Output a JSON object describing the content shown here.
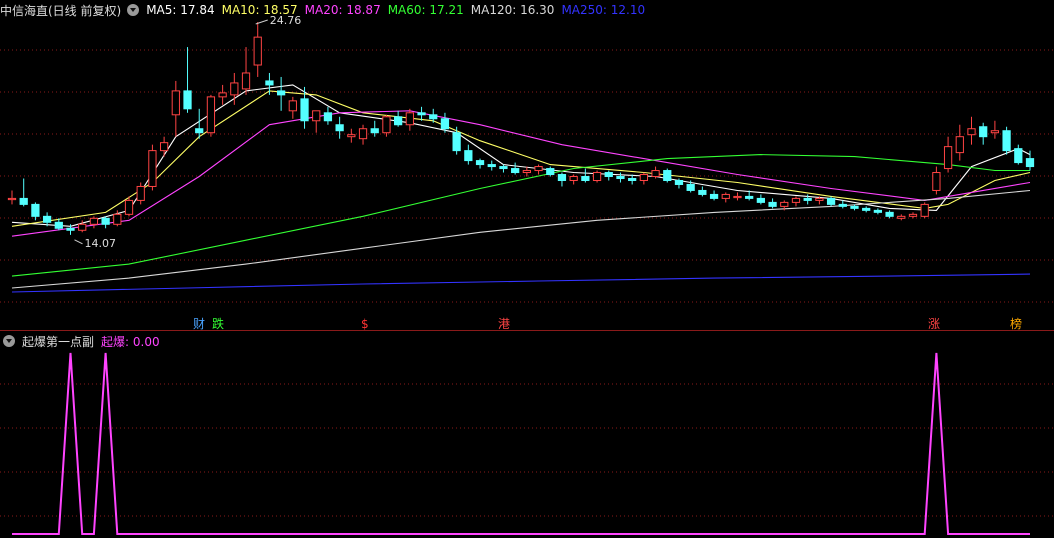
{
  "header": {
    "title": "中信海直(日线 前复权)",
    "ma5": {
      "label": "MA5: 17.84",
      "color": "#ffffff"
    },
    "ma10": {
      "label": "MA10: 18.57",
      "color": "#ffff66"
    },
    "ma20": {
      "label": "MA20: 18.87",
      "color": "#ff44ff"
    },
    "ma60": {
      "label": "MA60: 17.21",
      "color": "#33ff33"
    },
    "ma120": {
      "label": "MA120: 16.30",
      "color": "#d8d8d8"
    },
    "ma250": {
      "label": "MA250: 12.10",
      "color": "#3333ff"
    }
  },
  "annotations": {
    "high_label": "24.76",
    "low_label": "14.07"
  },
  "event_markers": [
    {
      "text": "财",
      "color": "#4aa3ff"
    },
    {
      "text": "跌",
      "color": "#33ff33"
    },
    {
      "text": "$",
      "color": "#ff3333"
    },
    {
      "text": "港",
      "color": "#ff4444"
    },
    {
      "text": "涨",
      "color": "#ff4444"
    },
    {
      "text": "榜",
      "color": "#ffaa00"
    }
  ],
  "sub_header": {
    "title": "起爆第一点副",
    "value_label": "起爆: 0.00",
    "color": "#ff44ff"
  },
  "colors": {
    "up": "#ff4444",
    "down": "#54ffff",
    "grid": "#8a1a1a",
    "signal": "#ff44ff"
  },
  "chart_data": {
    "type": "candlestick",
    "ohlc": [
      [
        15.9,
        16.3,
        15.6,
        15.9
      ],
      [
        15.9,
        16.9,
        15.5,
        15.6
      ],
      [
        15.6,
        15.7,
        14.8,
        15.0
      ],
      [
        15.0,
        15.2,
        14.5,
        14.7
      ],
      [
        14.7,
        14.9,
        14.3,
        14.4
      ],
      [
        14.4,
        14.6,
        14.07,
        14.3
      ],
      [
        14.3,
        14.8,
        14.2,
        14.6
      ],
      [
        14.6,
        15.0,
        14.4,
        14.9
      ],
      [
        14.9,
        15.0,
        14.4,
        14.6
      ],
      [
        14.6,
        15.3,
        14.5,
        15.1
      ],
      [
        15.1,
        16.0,
        15.0,
        15.8
      ],
      [
        15.8,
        16.7,
        15.6,
        16.5
      ],
      [
        16.5,
        18.6,
        16.3,
        18.3
      ],
      [
        18.3,
        19.0,
        18.0,
        18.7
      ],
      [
        20.1,
        21.8,
        19.0,
        21.3
      ],
      [
        21.3,
        23.5,
        20.2,
        20.4
      ],
      [
        19.4,
        20.4,
        18.9,
        19.2
      ],
      [
        19.2,
        21.1,
        19.0,
        21.0
      ],
      [
        21.0,
        21.6,
        20.6,
        21.2
      ],
      [
        21.1,
        22.2,
        20.6,
        21.7
      ],
      [
        21.4,
        23.5,
        21.1,
        22.2
      ],
      [
        22.6,
        24.76,
        22.0,
        24.0
      ],
      [
        21.8,
        22.2,
        21.1,
        21.6
      ],
      [
        21.3,
        22.0,
        20.3,
        21.1
      ],
      [
        20.3,
        21.0,
        19.9,
        20.8
      ],
      [
        20.9,
        21.5,
        19.4,
        19.8
      ],
      [
        19.8,
        20.3,
        19.2,
        20.3
      ],
      [
        20.2,
        20.5,
        19.6,
        19.8
      ],
      [
        19.6,
        20.0,
        18.9,
        19.3
      ],
      [
        19.0,
        19.4,
        18.7,
        19.1
      ],
      [
        18.9,
        19.6,
        18.6,
        19.4
      ],
      [
        19.4,
        19.8,
        19.0,
        19.2
      ],
      [
        19.2,
        20.1,
        19.0,
        20.0
      ],
      [
        20.0,
        20.3,
        19.5,
        19.6
      ],
      [
        19.6,
        20.4,
        19.3,
        20.2
      ],
      [
        20.2,
        20.5,
        19.8,
        20.1
      ],
      [
        20.1,
        20.4,
        19.7,
        19.9
      ],
      [
        19.9,
        20.2,
        19.2,
        19.4
      ],
      [
        19.2,
        19.5,
        18.1,
        18.3
      ],
      [
        18.3,
        18.6,
        17.6,
        17.8
      ],
      [
        17.8,
        17.9,
        17.4,
        17.6
      ],
      [
        17.6,
        17.8,
        17.3,
        17.5
      ],
      [
        17.5,
        17.6,
        17.2,
        17.4
      ],
      [
        17.4,
        17.7,
        17.1,
        17.2
      ],
      [
        17.2,
        17.5,
        17.0,
        17.3
      ],
      [
        17.3,
        17.6,
        17.1,
        17.5
      ],
      [
        17.4,
        17.5,
        17.0,
        17.1
      ],
      [
        17.1,
        17.2,
        16.5,
        16.8
      ],
      [
        16.8,
        17.1,
        16.6,
        17.0
      ],
      [
        17.0,
        17.4,
        16.7,
        16.8
      ],
      [
        16.8,
        17.3,
        16.7,
        17.2
      ],
      [
        17.2,
        17.3,
        16.8,
        17.0
      ],
      [
        17.0,
        17.2,
        16.7,
        16.9
      ],
      [
        16.9,
        17.1,
        16.6,
        16.8
      ],
      [
        16.8,
        17.2,
        16.6,
        17.1
      ],
      [
        17.0,
        17.5,
        16.9,
        17.3
      ],
      [
        17.3,
        17.4,
        16.7,
        16.8
      ],
      [
        16.8,
        16.9,
        16.4,
        16.6
      ],
      [
        16.6,
        16.8,
        16.2,
        16.3
      ],
      [
        16.3,
        16.5,
        16.0,
        16.1
      ],
      [
        16.1,
        16.3,
        15.8,
        15.9
      ],
      [
        15.9,
        16.2,
        15.7,
        16.1
      ],
      [
        16.0,
        16.2,
        15.8,
        16.0
      ],
      [
        16.0,
        16.3,
        15.8,
        15.9
      ],
      [
        15.9,
        16.1,
        15.6,
        15.7
      ],
      [
        15.7,
        15.9,
        15.4,
        15.5
      ],
      [
        15.5,
        15.8,
        15.3,
        15.7
      ],
      [
        15.7,
        16.0,
        15.5,
        15.9
      ],
      [
        15.9,
        16.1,
        15.6,
        15.8
      ],
      [
        15.8,
        16.0,
        15.6,
        15.9
      ],
      [
        15.9,
        16.0,
        15.5,
        15.6
      ],
      [
        15.6,
        15.8,
        15.4,
        15.5
      ],
      [
        15.5,
        15.6,
        15.3,
        15.4
      ],
      [
        15.4,
        15.5,
        15.2,
        15.3
      ],
      [
        15.3,
        15.4,
        15.1,
        15.2
      ],
      [
        15.2,
        15.3,
        14.9,
        15.0
      ],
      [
        14.9,
        15.1,
        14.8,
        15.0
      ],
      [
        15.0,
        15.2,
        14.9,
        15.1
      ],
      [
        15.0,
        15.7,
        14.9,
        15.6
      ],
      [
        16.3,
        17.5,
        16.1,
        17.2
      ],
      [
        17.4,
        19.0,
        17.2,
        18.5
      ],
      [
        18.2,
        19.6,
        17.8,
        19.0
      ],
      [
        19.1,
        20.0,
        18.6,
        19.4
      ],
      [
        19.5,
        19.7,
        18.6,
        19.0
      ],
      [
        19.2,
        19.8,
        18.9,
        19.3
      ],
      [
        19.3,
        19.5,
        18.1,
        18.3
      ],
      [
        18.4,
        18.6,
        17.6,
        17.7
      ],
      [
        17.9,
        18.3,
        17.3,
        17.5
      ]
    ],
    "signal_values": [
      0,
      0,
      0,
      0,
      0,
      0,
      0,
      0,
      0,
      0,
      0,
      0,
      0,
      0,
      0,
      0,
      0,
      0,
      0,
      0,
      0,
      0,
      0,
      0,
      0,
      0,
      0,
      0,
      0,
      0,
      0,
      0,
      0,
      0,
      0,
      0,
      0,
      0,
      0,
      0,
      0,
      0,
      0,
      0,
      0,
      0,
      0,
      0,
      0,
      0,
      0,
      0,
      0,
      0,
      0,
      0,
      0,
      0,
      0,
      0,
      0,
      0,
      0,
      0,
      0,
      0,
      0,
      0,
      0,
      0,
      0,
      0,
      0,
      0,
      0,
      0,
      0,
      0,
      0,
      0,
      0,
      0,
      0,
      0,
      0,
      0,
      0,
      0
    ],
    "signal_spike_indices": [
      5,
      8,
      79
    ],
    "ma_series": [
      {
        "name": "MA5",
        "color": "#ffffff",
        "points": [
          [
            0,
            14.7
          ],
          [
            5,
            14.5
          ],
          [
            10,
            15.3
          ],
          [
            14,
            19.0
          ],
          [
            20,
            21.3
          ],
          [
            24,
            21.6
          ],
          [
            28,
            20.2
          ],
          [
            34,
            19.7
          ],
          [
            38,
            19.2
          ],
          [
            42,
            17.6
          ],
          [
            48,
            17.2
          ],
          [
            55,
            17.0
          ],
          [
            62,
            16.3
          ],
          [
            70,
            15.9
          ],
          [
            75,
            15.4
          ],
          [
            79,
            15.3
          ],
          [
            82,
            17.5
          ],
          [
            86,
            18.4
          ],
          [
            87,
            18.1
          ]
        ]
      },
      {
        "name": "MA10",
        "color": "#ffff66",
        "points": [
          [
            0,
            14.5
          ],
          [
            8,
            15.2
          ],
          [
            12,
            16.7
          ],
          [
            16,
            19.0
          ],
          [
            22,
            21.3
          ],
          [
            26,
            21.1
          ],
          [
            30,
            20.2
          ],
          [
            36,
            19.8
          ],
          [
            40,
            18.8
          ],
          [
            46,
            17.6
          ],
          [
            54,
            17.2
          ],
          [
            62,
            16.7
          ],
          [
            70,
            16.0
          ],
          [
            78,
            15.4
          ],
          [
            80,
            15.6
          ],
          [
            84,
            16.8
          ],
          [
            87,
            17.2
          ]
        ]
      },
      {
        "name": "MA20",
        "color": "#ff44ff",
        "points": [
          [
            0,
            14.0
          ],
          [
            10,
            14.8
          ],
          [
            16,
            17.0
          ],
          [
            22,
            19.6
          ],
          [
            28,
            20.2
          ],
          [
            34,
            20.3
          ],
          [
            40,
            19.6
          ],
          [
            47,
            18.6
          ],
          [
            55,
            17.8
          ],
          [
            62,
            17.1
          ],
          [
            70,
            16.4
          ],
          [
            78,
            15.8
          ],
          [
            82,
            16.2
          ],
          [
            87,
            16.7
          ]
        ]
      },
      {
        "name": "MA60",
        "color": "#33ff33",
        "points": [
          [
            0,
            12.0
          ],
          [
            10,
            12.6
          ],
          [
            20,
            13.8
          ],
          [
            30,
            15.0
          ],
          [
            40,
            16.4
          ],
          [
            48,
            17.4
          ],
          [
            56,
            17.9
          ],
          [
            64,
            18.1
          ],
          [
            72,
            18.0
          ],
          [
            80,
            17.6
          ],
          [
            84,
            17.3
          ],
          [
            87,
            17.3
          ]
        ]
      },
      {
        "name": "MA120",
        "color": "#d8d8d8",
        "points": [
          [
            0,
            11.4
          ],
          [
            10,
            11.9
          ],
          [
            20,
            12.6
          ],
          [
            30,
            13.4
          ],
          [
            40,
            14.2
          ],
          [
            50,
            14.8
          ],
          [
            60,
            15.2
          ],
          [
            70,
            15.5
          ],
          [
            80,
            15.9
          ],
          [
            87,
            16.3
          ]
        ]
      },
      {
        "name": "MA250",
        "color": "#3333ff",
        "points": [
          [
            0,
            11.2
          ],
          [
            15,
            11.4
          ],
          [
            30,
            11.6
          ],
          [
            45,
            11.75
          ],
          [
            60,
            11.9
          ],
          [
            75,
            12.0
          ],
          [
            87,
            12.1
          ]
        ]
      }
    ]
  }
}
